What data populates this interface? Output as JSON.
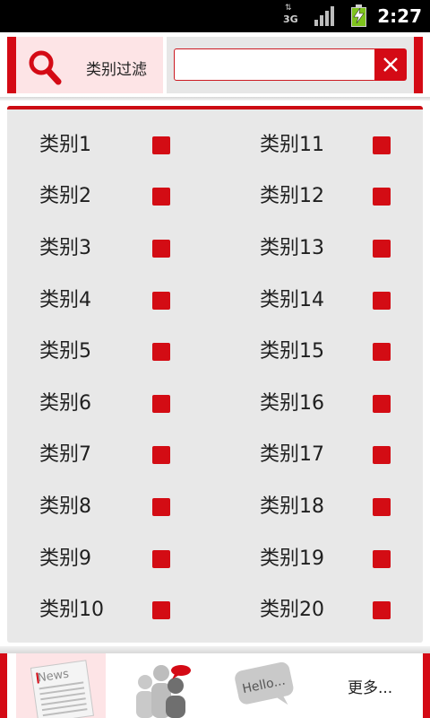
{
  "status_bar": {
    "network": "3G",
    "time": "2:27"
  },
  "header": {
    "filter_label": "类别过滤",
    "search_value": "",
    "colors": {
      "accent": "#d40a15",
      "filter_bg": "#fde4e6"
    }
  },
  "categories": {
    "left": [
      "类别1",
      "类别2",
      "类别3",
      "类别4",
      "类别5",
      "类别6",
      "类别7",
      "类别8",
      "类别9",
      "类别10"
    ],
    "right": [
      "类别11",
      "类别12",
      "类别13",
      "类别14",
      "类别15",
      "类别16",
      "类别17",
      "类别18",
      "类别19",
      "类别20"
    ]
  },
  "bottom_nav": {
    "news_icon_text": "News",
    "hello_icon_text": "Hello...",
    "more_label": "更多..."
  }
}
